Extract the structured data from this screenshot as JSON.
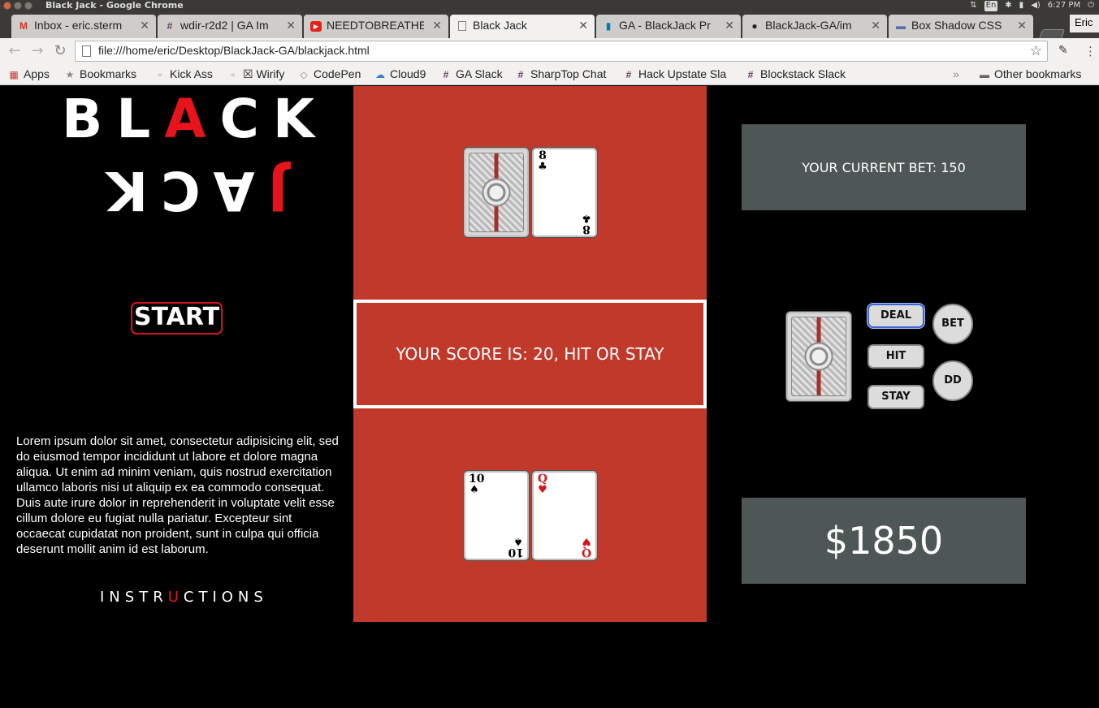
{
  "window": {
    "title": "Black Jack - Google Chrome"
  },
  "tray": {
    "keyboard": "En",
    "time": "6:27 PM"
  },
  "tabs": [
    {
      "label": "Inbox - eric.sterm",
      "icon": "M"
    },
    {
      "label": "wdir-r2d2 | GA Im",
      "icon": "#"
    },
    {
      "label": "NEEDTOBREATHE",
      "icon": "▶"
    },
    {
      "label": "Black Jack",
      "icon": ""
    },
    {
      "label": "GA - BlackJack Pr",
      "icon": "▮"
    },
    {
      "label": "BlackJack-GA/im",
      "icon": "●"
    },
    {
      "label": "Box Shadow CSS",
      "icon": "▬"
    }
  ],
  "profile": {
    "name": "Eric"
  },
  "address": {
    "url": "file:///home/eric/Desktop/BlackJack-GA/blackjack.html"
  },
  "bookmarks": {
    "items": [
      "Apps",
      "Bookmarks",
      "Kick Ass",
      "☒ Wirify",
      "CodePen",
      "Cloud9",
      "GA Slack",
      "SharpTop Chat",
      "Hack Upstate Sla",
      "Blockstack Slack"
    ],
    "other": "Other bookmarks"
  },
  "logo": {
    "top_pre": "BL",
    "top_accent": "A",
    "top_post": "CK",
    "bottom_accent": "J",
    "bottom_rest": "ACK"
  },
  "start_label": "START",
  "lorem": "Lorem ipsum dolor sit amet, consectetur adipisicing elit, sed do eiusmod tempor incididunt ut labore et dolore magna aliqua. Ut enim ad minim veniam, quis nostrud exercitation ullamco laboris nisi ut aliquip ex ea commodo consequat. Duis aute irure dolor in reprehenderit in voluptate velit esse cillum dolore eu fugiat nulla pariatur. Excepteur sint occaecat cupidatat non proident, sunt in culpa qui officia deserunt mollit anim id est laborum.",
  "instructions": {
    "pre": "INSTR",
    "accent": "U",
    "post": "CTIONS"
  },
  "dealer": {
    "cards": [
      {
        "face": "back"
      },
      {
        "rank": "8",
        "suit": "♣",
        "color": "black"
      }
    ]
  },
  "player": {
    "cards": [
      {
        "rank": "10",
        "suit": "♠",
        "color": "black"
      },
      {
        "rank": "Q",
        "suit": "♥",
        "color": "red"
      }
    ]
  },
  "score_text": "YOUR SCORE IS: 20, HIT OR STAY",
  "bet_text": "YOUR CURRENT BET: 150",
  "bankroll": "$1850",
  "controls": {
    "deal": "DEAL",
    "hit": "HIT",
    "stay": "STAY",
    "bet": "BET",
    "dd": "DD"
  },
  "colors": {
    "table": "#c0392b",
    "accent": "#e8141b",
    "panel": "#4f5656"
  }
}
